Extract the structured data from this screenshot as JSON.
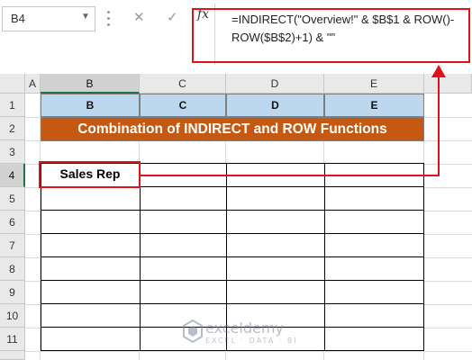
{
  "formula_bar": {
    "name_box": "B4",
    "fx_label": "fx",
    "formula": "=INDIRECT(\"Overview!\" & $B$1 & ROW()-ROW($B$2)+1) & \"\""
  },
  "columns": [
    "A",
    "B",
    "C",
    "D",
    "E"
  ],
  "rows": [
    "1",
    "2",
    "3",
    "4",
    "5",
    "6",
    "7",
    "8",
    "9",
    "10",
    "11"
  ],
  "row1_cells": [
    "B",
    "C",
    "D",
    "E"
  ],
  "title": "Combination of INDIRECT and ROW Functions",
  "cell_b4": "Sales Rep",
  "watermark": {
    "name": "exceldemy",
    "tagline": "EXCEL · DATA · BI"
  },
  "colors": {
    "highlight": "#e0101c",
    "title_fill": "#c65911",
    "header_fill": "#bdd7ee",
    "selection": "#217346"
  }
}
